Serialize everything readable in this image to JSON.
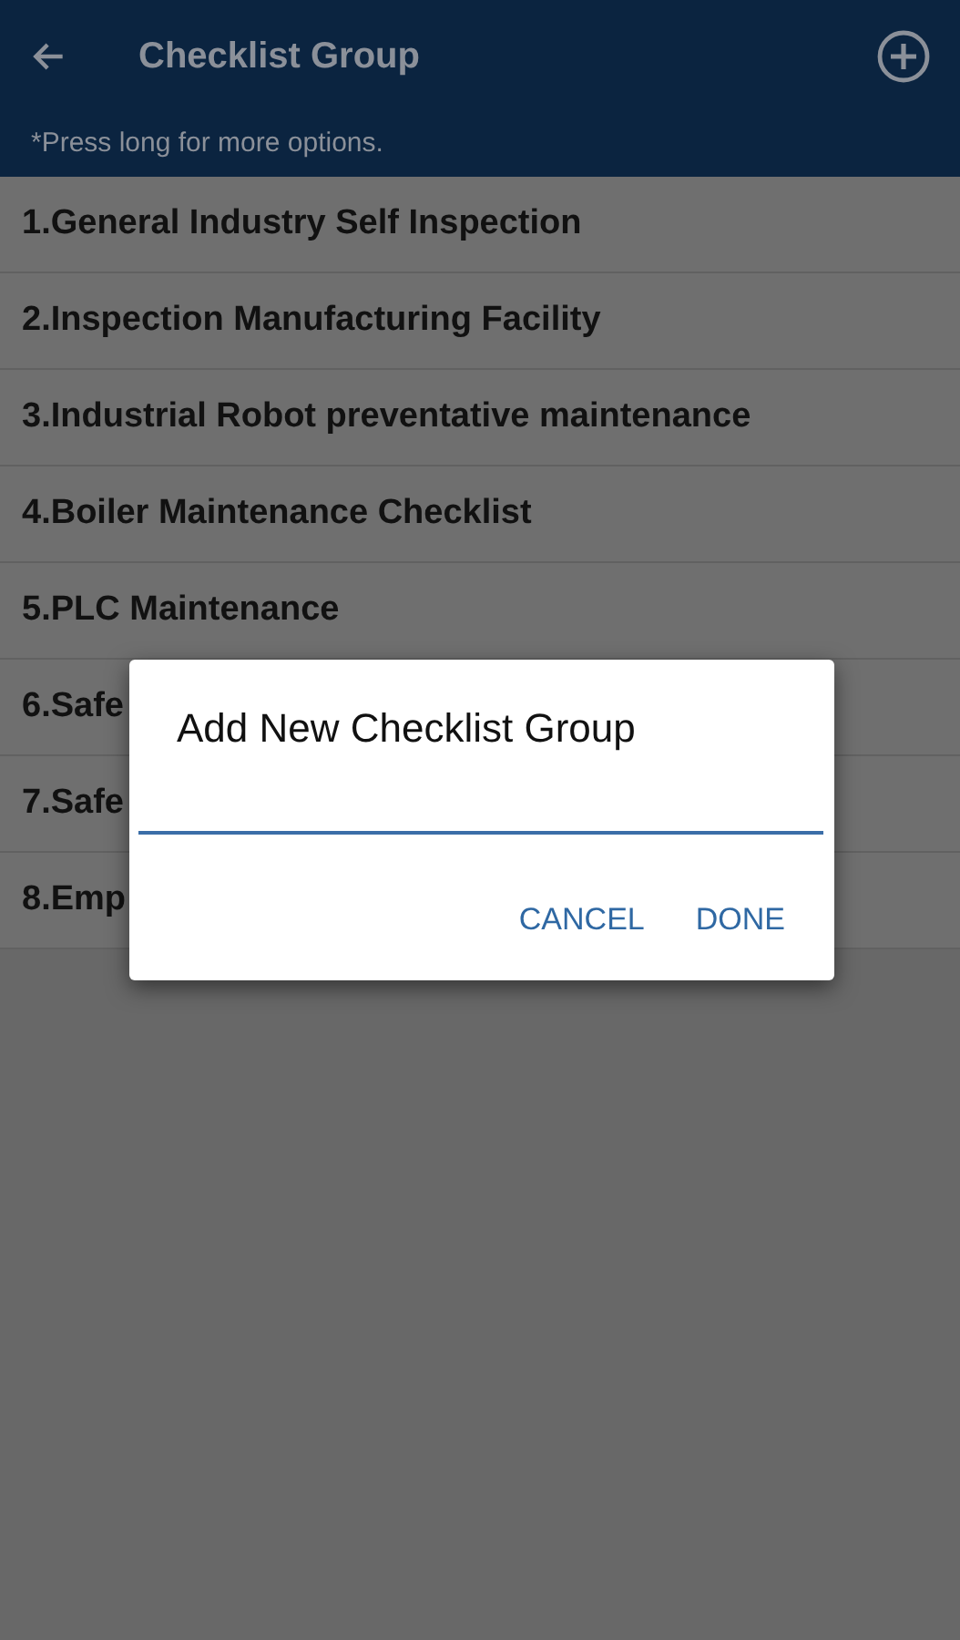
{
  "app_bar": {
    "title": "Checklist Group",
    "hint": "*Press long for more options."
  },
  "items": [
    {
      "label": "1.General Industry Self Inspection"
    },
    {
      "label": "2.Inspection Manufacturing Facility"
    },
    {
      "label": "3.Industrial Robot preventative maintenance"
    },
    {
      "label": "4.Boiler Maintenance Checklist"
    },
    {
      "label": "5.PLC Maintenance"
    },
    {
      "label": "6.Safe"
    },
    {
      "label": "7.Safe"
    },
    {
      "label": "8.Emp"
    }
  ],
  "dialog": {
    "title": "Add New Checklist Group",
    "buttons": [
      "CANCEL",
      "DONE"
    ]
  }
}
